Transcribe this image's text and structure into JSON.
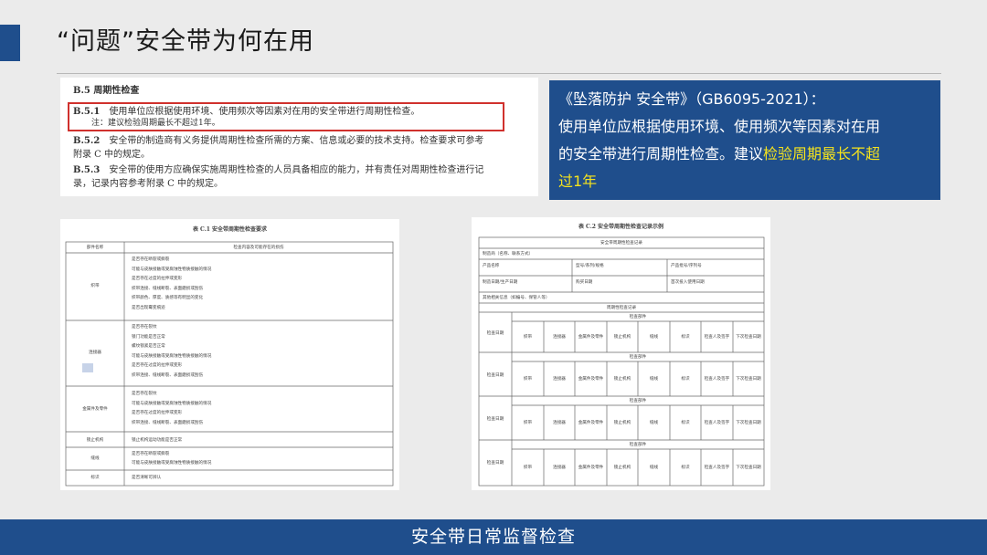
{
  "slide": {
    "title": "“问题”安全带为何在用",
    "footer": "安全带日常监督检查"
  },
  "excerpt": {
    "heading": "B.5  周期性检查",
    "b51_num": "B.5.1",
    "b51_text": "使用单位应根据使用环境、使用频次等因素对在用的安全带进行周期性检查。",
    "note": "注：建议检验周期最长不超过1年。",
    "b52_num": "B.5.2",
    "b52_text_1": "安全带的制造商有义务提供周期性检查所需的方案、信息或必要的技术支持。检查要求可参考",
    "b52_text_2": "附录 C 中的规定。",
    "b53_num": "B.5.3",
    "b53_text_1": "安全带的使用方应确保实施周期性检查的人员具备相应的能力，并有责任对周期性检查进行记",
    "b53_text_2": "录，记录内容参考附录 C 中的规定。"
  },
  "callout": {
    "line1": "《坠落防护 安全带》（GB6095-2021）：",
    "line2": "使用单位应根据使用环境、使用频次等因素对在用",
    "line3_normal": "的安全带进行周期性检查。建议",
    "line3_highlight": "检验周期最长不超",
    "line4_highlight": "过1年",
    "highlight_color": "#f5e31d"
  },
  "table_c1": {
    "caption": "表 C.1  安全带周期性检查要求",
    "col1": "部件名称",
    "col2": "检查内容及可能存在的损伤",
    "rows": [
      {
        "name": "织带",
        "items": [
          "是否存在断裂或撕裂",
          "可能与皮肤接触或受腐蚀性物质接触的情况",
          "是否存在过度的拉伸或变形",
          "织带连接、缝线断裂、表面磨损或刮伤",
          "织带颜色、厚度、质感等有明显的变化",
          "是否出现霉变痕迹"
        ]
      },
      {
        "name": "连接器",
        "items": [
          "是否存在裂纹",
          "锁门功能是否正常",
          "螺纹锁紧是否正常",
          "可能与皮肤接触或受腐蚀性物质接触的情况",
          "是否存在过度的拉伸或变形",
          "织带连接、缝线断裂、表面磨损或刮伤"
        ]
      },
      {
        "name": "金属件及零件",
        "items": [
          "是否存在裂纹",
          "可能与皮肤接触或受腐蚀性物质接触的情况",
          "是否存在过度的拉伸或变形",
          "织带连接、缝线断裂、表面磨损或刮伤"
        ]
      },
      {
        "name": "锁止机构",
        "items": [
          "锁止机构运动功能是否正常"
        ]
      },
      {
        "name": "缝线",
        "items": [
          "是否存在断裂或撕裂",
          "可能与皮肤接触或受腐蚀性物质接触的情况"
        ]
      },
      {
        "name": "标识",
        "items": [
          "是否清晰可辨认"
        ]
      }
    ]
  },
  "table_c2": {
    "caption": "表 C.2  安全带周期性检查记录示例",
    "header_title": "安全带周期性检查记录",
    "info_rows": [
      [
        "制造商（名称、联系方式）"
      ],
      [
        "产品名称",
        "型号/系列/规格",
        "产品批号/序列号"
      ],
      [
        "制造日期/生产日期",
        "购买日期",
        "首次投入使用日期"
      ],
      [
        "其他相关信息（如编号、保管人等）"
      ]
    ],
    "record_title": "周期性检查记录",
    "check_label": "检查日期",
    "part_label": "检查部件",
    "columns": [
      "织带",
      "连接器",
      "金属件及零件",
      "锁止机构",
      "缝线",
      "标识",
      "检查人及签字",
      "下次检查日期"
    ]
  }
}
